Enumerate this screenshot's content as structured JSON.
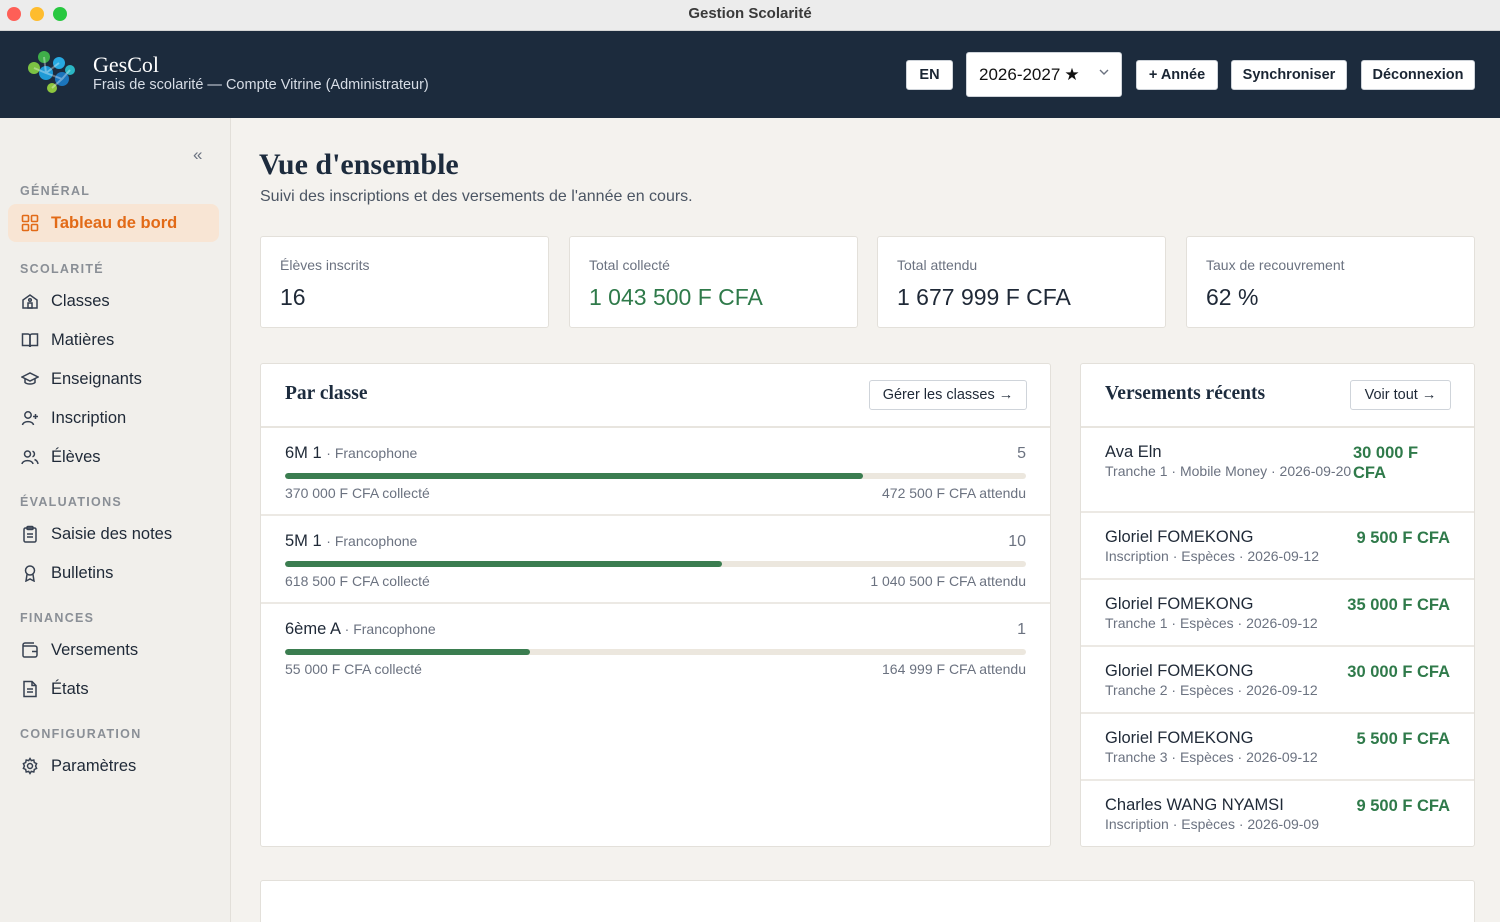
{
  "window": {
    "title": "Gestion Scolarité"
  },
  "header": {
    "brand": "GesCol",
    "subtitle": "Frais de scolarité — Compte Vitrine (Administrateur)",
    "lang_button": "EN",
    "year": "2026-2027",
    "add_year": "+ Année",
    "sync": "Synchroniser",
    "logout": "Déconnexion"
  },
  "sidebar": {
    "sections": [
      {
        "label": "GÉNÉRAL",
        "items": [
          {
            "label": "Tableau de bord",
            "icon": "grid-icon",
            "active": true
          }
        ]
      },
      {
        "label": "SCOLARITÉ",
        "items": [
          {
            "label": "Classes",
            "icon": "school-icon"
          },
          {
            "label": "Matières",
            "icon": "book-icon"
          },
          {
            "label": "Enseignants",
            "icon": "graduation-cap-icon"
          },
          {
            "label": "Inscription",
            "icon": "user-plus-icon"
          },
          {
            "label": "Élèves",
            "icon": "users-icon"
          }
        ]
      },
      {
        "label": "ÉVALUATIONS",
        "items": [
          {
            "label": "Saisie des notes",
            "icon": "clipboard-icon"
          },
          {
            "label": "Bulletins",
            "icon": "award-icon"
          }
        ]
      },
      {
        "label": "FINANCES",
        "items": [
          {
            "label": "Versements",
            "icon": "wallet-icon"
          },
          {
            "label": "États",
            "icon": "document-icon"
          }
        ]
      },
      {
        "label": "CONFIGURATION",
        "items": [
          {
            "label": "Paramètres",
            "icon": "gear-icon"
          }
        ]
      }
    ]
  },
  "main": {
    "title": "Vue d'ensemble",
    "subtitle": "Suivi des inscriptions et des versements de l'année en cours.",
    "stats": [
      {
        "label": "Élèves inscrits",
        "value": "16"
      },
      {
        "label": "Total collecté",
        "value": "1 043 500 F CFA",
        "accent": "#2f7a4a"
      },
      {
        "label": "Total attendu",
        "value": "1 677 999 F CFA"
      },
      {
        "label": "Taux de recouvrement",
        "value": "62 %"
      }
    ],
    "by_class": {
      "title": "Par classe",
      "button": "Gérer les classes →",
      "rows": [
        {
          "name": "6M 1",
          "language": "· Francophone",
          "count": "5",
          "collected": "370 000 F CFA collecté",
          "expected": "472 500 F CFA attendu",
          "progress": 0.78
        },
        {
          "name": "5M 1",
          "language": "· Francophone",
          "count": "10",
          "collected": "618 500 F CFA collecté",
          "expected": "1 040 500 F CFA attendu",
          "progress": 0.59
        },
        {
          "name": "6ème A",
          "language": "· Francophone",
          "count": "1",
          "collected": "55 000 F CFA collecté",
          "expected": "164 999 F CFA attendu",
          "progress": 0.33
        }
      ]
    },
    "recent_payments": {
      "title": "Versements récents",
      "button": "Voir tout →",
      "rows": [
        {
          "name": "Ava Eln",
          "detail": "Tranche 1 · Mobile Money · 2026-09-20",
          "amount": "30 000 F CFA"
        },
        {
          "name": "Gloriel FOMEKONG",
          "detail": "Inscription · Espèces · 2026-09-12",
          "amount": "9 500 F CFA"
        },
        {
          "name": "Gloriel FOMEKONG",
          "detail": "Tranche 1 · Espèces · 2026-09-12",
          "amount": "35 000 F CFA"
        },
        {
          "name": "Gloriel FOMEKONG",
          "detail": "Tranche 2 · Espèces · 2026-09-12",
          "amount": "30 000 F CFA"
        },
        {
          "name": "Gloriel FOMEKONG",
          "detail": "Tranche 3 · Espèces · 2026-09-12",
          "amount": "5 500 F CFA"
        },
        {
          "name": "Charles WANG NYAMSI",
          "detail": "Inscription · Espèces · 2026-09-09",
          "amount": "9 500 F CFA"
        }
      ]
    }
  },
  "colors": {
    "header_bg": "#1c2b3d",
    "accent_orange": "#e26a17",
    "accent_green": "#2f7a4a",
    "active_bg": "#f8e5d4"
  }
}
